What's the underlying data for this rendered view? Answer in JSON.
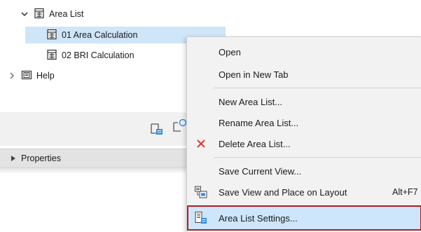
{
  "navigator": {
    "tree": [
      {
        "label": "Area List",
        "state": "expanded"
      },
      {
        "label": "01 Area Calculation",
        "state": "selected"
      },
      {
        "label": "02 BRI Calculation",
        "state": "normal"
      },
      {
        "label": "Help",
        "state": "collapsed"
      }
    ],
    "properties_label": "Properties"
  },
  "context_menu": {
    "items": [
      {
        "label": "Open"
      },
      {
        "label": "Open in New Tab"
      },
      {
        "label": "New Area List..."
      },
      {
        "label": "Rename Area List..."
      },
      {
        "label": "Delete Area List...",
        "icon": "delete-x-icon"
      },
      {
        "label": "Save Current View..."
      },
      {
        "label": "Save View and Place on Layout",
        "shortcut": "Alt+F7",
        "icon": "save-place-layout-icon"
      },
      {
        "label": "Area List Settings...",
        "icon": "list-settings-icon",
        "highlighted": true
      }
    ]
  },
  "colors": {
    "selection": "#cfe5f8",
    "menu_background": "#f2f2f2",
    "highlight_outline": "#b01e24",
    "delete_icon": "#e0392b",
    "accent_icon": "#2e8ae6"
  }
}
